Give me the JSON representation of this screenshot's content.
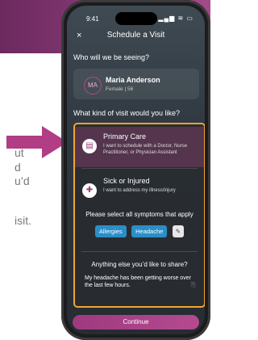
{
  "background": {
    "side_text_lines": [
      "ut",
      "d",
      "u’d",
      "isit."
    ]
  },
  "status_bar": {
    "time": "9:41",
    "icons": "▂▄▆ ≋ ▭"
  },
  "header": {
    "close_icon": "close-icon",
    "close_glyph": "×",
    "title": "Schedule a Visit"
  },
  "question_who": "Who will we be seeing?",
  "patient": {
    "initials": "MA",
    "name": "Maria Anderson",
    "details": "Female | 56"
  },
  "question_kind": "What kind of visit would you like?",
  "options": [
    {
      "title": "Primary Care",
      "description": "I want to schedule with a Doctor, Nurse Practitioner, or Physician Assistant",
      "icon": "clipboard-icon",
      "glyph": "▤"
    },
    {
      "title": "Sick or Injured",
      "description": "I want to address my illness/injury",
      "icon": "thermometer-icon",
      "glyph": "✚"
    }
  ],
  "symptoms": {
    "label": "Please select all symptoms that apply",
    "chips": [
      "Allergies",
      "Headache"
    ],
    "edit_glyph": "✎"
  },
  "notes": {
    "label": "Anything else you’d like to share?",
    "text": "My headache has been getting worse over the last few hours.",
    "mic_glyph": "⎘"
  },
  "continue_label": "Continue",
  "colors": {
    "accent": "#b54a8f",
    "highlight_border": "#f2a431",
    "chip": "#2a8fc8"
  }
}
